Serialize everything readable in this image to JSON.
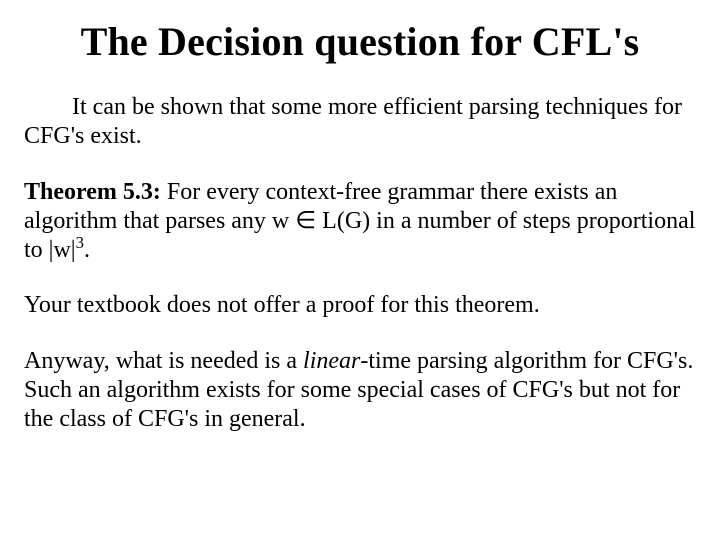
{
  "title": "The Decision question for CFL's",
  "p1": "It can be shown that some more efficient parsing techniques for CFG's exist.",
  "theorem_label": "Theorem 5.3:",
  "theorem_a": "  For every context-free grammar there exists an algorithm that parses any w ",
  "theorem_in": "∈",
  "theorem_b": " L(G) in a number of steps proportional to |w|",
  "theorem_exp": "3",
  "theorem_c": ".",
  "p3": "Your textbook does not offer a proof for this theorem.",
  "p4_a": "Anyway, what is needed is a ",
  "p4_linear": "linear",
  "p4_b": "-time parsing algorithm for CFG's.  Such an algorithm exists for some special cases of CFG's but not for the class of CFG's in general."
}
